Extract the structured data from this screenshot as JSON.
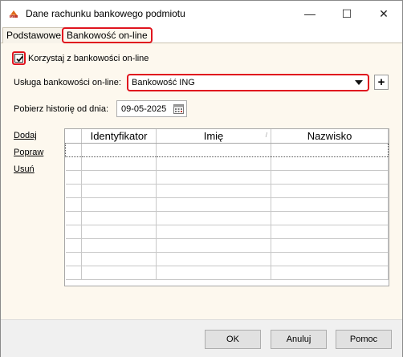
{
  "window": {
    "title": "Dane rachunku bankowego podmiotu",
    "minimize_glyph": "—",
    "maximize_glyph": "☐",
    "close_glyph": "✕"
  },
  "tabs": [
    {
      "label": "Podstawowe",
      "active": false
    },
    {
      "label": "Bankowość on-line",
      "active": true
    }
  ],
  "form": {
    "use_online_label": "Korzystaj z bankowości on-line",
    "use_online_checked": true,
    "service_label": "Usługa bankowości on-line:",
    "service_value": "Bankowość ING",
    "add_glyph": "+",
    "history_label": "Pobierz historię od dnia:",
    "history_date": "09-05-2025"
  },
  "actions": {
    "add": "Dodaj",
    "edit": "Popraw",
    "delete": "Usuń"
  },
  "table": {
    "columns": [
      "",
      "Identyfikator",
      "Imię",
      "Nazwisko"
    ],
    "sort_glyph": "/",
    "rows": 10
  },
  "buttons": {
    "ok": "OK",
    "cancel": "Anuluj",
    "help": "Pomoc"
  },
  "colors": {
    "highlight": "#e0141e",
    "panel": "#fdf8ee"
  },
  "icons": [
    "app-icon",
    "minimize-icon",
    "maximize-icon",
    "close-icon",
    "checkmark-icon",
    "dropdown-arrow-icon",
    "calendar-icon"
  ]
}
